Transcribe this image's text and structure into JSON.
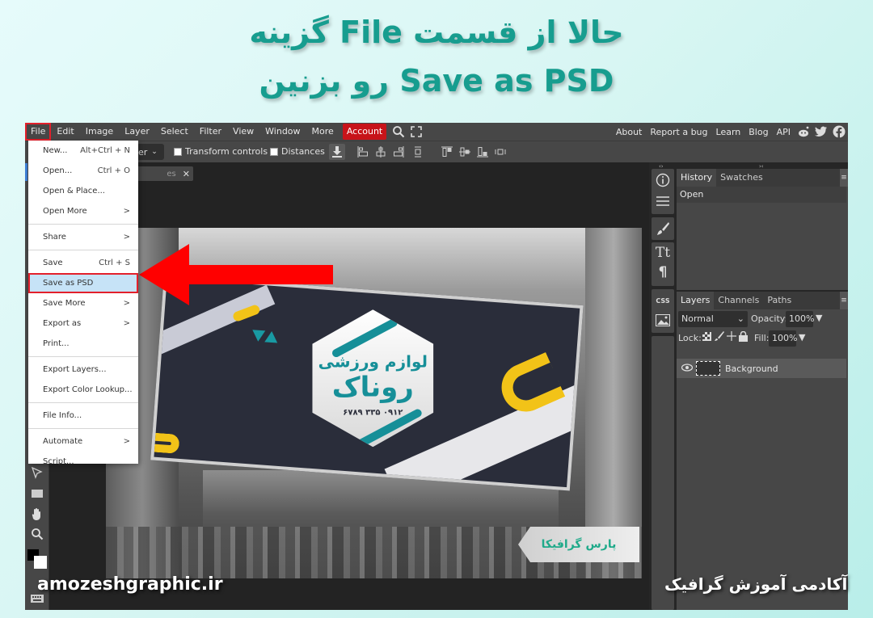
{
  "banner": {
    "line1": "حالا از قسمت File گزینه",
    "line2": "Save as PSD رو بزنین",
    "color": "#179d8f"
  },
  "menubar": {
    "items": [
      "File",
      "Edit",
      "Image",
      "Layer",
      "Select",
      "Filter",
      "View",
      "Window",
      "More"
    ],
    "account": "Account",
    "links": [
      "About",
      "Report a bug",
      "Learn",
      "Blog",
      "API"
    ],
    "icons": [
      "search-icon",
      "fullscreen-icon",
      "reddit-icon",
      "twitter-icon",
      "facebook-icon"
    ],
    "highlight_color": "#e3202b",
    "account_color": "#c7141a"
  },
  "optbar": {
    "select_value": "er",
    "transform_controls": "Transform controls",
    "distances": "Distances"
  },
  "document": {
    "tab_label": "es",
    "close": "✕"
  },
  "billboard": {
    "title": "لوازم ورزشی",
    "brand": "روناک",
    "phone": "۰۹۱۲ ۳۳۵ ۶۷۸۹",
    "watermark": "پارس گرافیکا"
  },
  "file_menu": {
    "items": [
      {
        "label": "New...",
        "shortcut": "Alt+Ctrl + N"
      },
      {
        "label": "Open...",
        "shortcut": "Ctrl + O"
      },
      {
        "label": "Open & Place..."
      },
      {
        "label": "Open More",
        "submenu": true
      },
      {
        "label": "Share",
        "submenu": true
      },
      {
        "label": "Save",
        "shortcut": "Ctrl + S"
      },
      {
        "label": "Save as PSD",
        "highlighted": true
      },
      {
        "label": "Save More",
        "submenu": true
      },
      {
        "label": "Export as",
        "submenu": true
      },
      {
        "label": "Print..."
      },
      {
        "label": "Export Layers..."
      },
      {
        "label": "Export Color Lookup..."
      },
      {
        "label": "File Info..."
      },
      {
        "label": "Automate",
        "submenu": true
      },
      {
        "label": "Script..."
      }
    ],
    "submenu_glyph": ">"
  },
  "right_strip": {
    "icons": [
      "info-icon",
      "adjustments-icon",
      "brush-icon",
      "text-icon",
      "paragraph-icon",
      "css-icon",
      "image-icon"
    ],
    "css_label": "CSS"
  },
  "history_panel": {
    "tabs": [
      "History",
      "Swatches"
    ],
    "entries": [
      "Open"
    ]
  },
  "layers_panel": {
    "tabs": [
      "Layers",
      "Channels",
      "Paths"
    ],
    "blend_mode": "Normal",
    "opacity_label": "Opacity:",
    "opacity_value": "100%",
    "lock_label": "Lock:",
    "fill_label": "Fill:",
    "fill_value": "100%",
    "layers": [
      {
        "name": "Background",
        "visible": true
      }
    ]
  },
  "watermarks": {
    "left": "amozeshgraphic.ir",
    "right": "آکادمی آموزش گرافیک"
  }
}
